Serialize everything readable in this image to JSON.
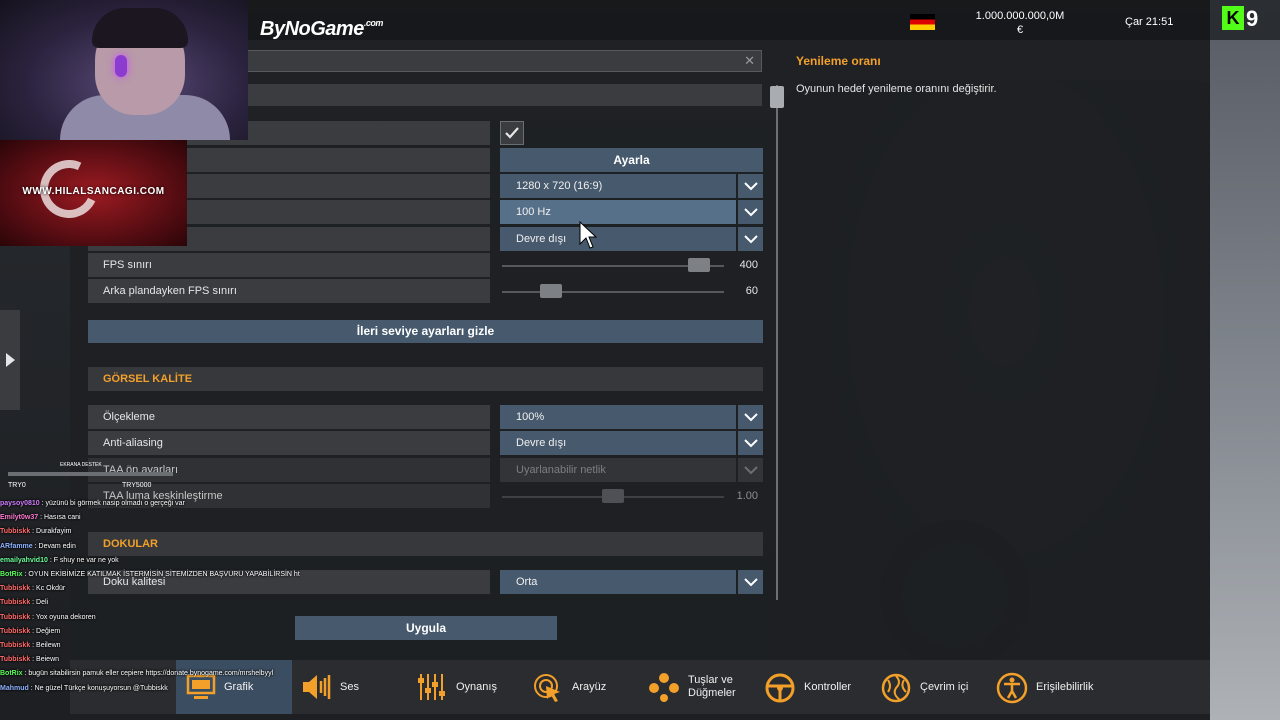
{
  "topbar": {
    "brand": "ByNoGame",
    "brand_suffix": ".com",
    "money": "1.000.000.000,0M",
    "currency": "€",
    "clock": "Çar 21:51"
  },
  "kick": {
    "letter": "K",
    "number": "9"
  },
  "settings": {
    "apply_button": "Ayarla",
    "resolution": "1280 x 720 (16:9)",
    "refresh_rate": "100 Hz",
    "vsync": "Devre dışı",
    "fps_limit_label": "FPS sınırı",
    "fps_limit_value": "400",
    "fps_limit_fraction": 0.93,
    "bg_fps_label": "Arka plandayken FPS sınırı",
    "bg_fps_value": "60",
    "bg_fps_fraction": 0.19,
    "advanced_toggle": "İleri seviye ayarları gizle",
    "section_visual": "GÖRSEL KALİTE",
    "scaling_label": "Ölçekleme",
    "scaling_value": "100%",
    "aa_label": "Anti-aliasing",
    "aa_value": "Devre dışı",
    "taa_preset_label": "TAA ön ayarları",
    "taa_preset_value": "Uyarlanabilir netlik",
    "taa_sharpen_label": "TAA luma keskinleştirme",
    "taa_sharpen_value": "1.00",
    "taa_sharpen_fraction": 0.5,
    "section_textures": "DOKULAR",
    "texture_quality_label": "Doku kalitesi",
    "texture_quality_value": "Orta",
    "apply": "Uygula"
  },
  "description": {
    "title": "Yenileme oranı",
    "text": "Oyunun hedef yenileme oranını değiştirir."
  },
  "nav": [
    {
      "label": "Grafik",
      "icon": "monitor-icon"
    },
    {
      "label": "Ses",
      "icon": "speaker-icon"
    },
    {
      "label": "Oynanış",
      "icon": "sliders-icon"
    },
    {
      "label": "Arayüz",
      "icon": "cursor-icon"
    },
    {
      "label_1": "Tuşlar ve",
      "label_2": "Düğmeler",
      "icon": "buttons-icon"
    },
    {
      "label": "Kontroller",
      "icon": "steering-wheel-icon"
    },
    {
      "label": "Çevrim içi",
      "icon": "globe-icon"
    },
    {
      "label": "Erişilebilirlik",
      "icon": "accessibility-icon"
    }
  ],
  "stream": {
    "banner_text": "WWW.HILALSANCAGI.COM",
    "donation_title": "EKRANA DESTEK",
    "donation_left": "TRY0",
    "donation_right": "TRY5000",
    "chat": [
      {
        "user": "paysoy0810",
        "text": "yüzünü bi görmek nasip olmadı o gerçeği var",
        "color": "#d17dff"
      },
      {
        "user": "Emilyt0w37",
        "text": "Hasısa cani",
        "color": "#ff7bd2"
      },
      {
        "user": "Tubbiskk",
        "text": "Durakfayim",
        "color": "#ff6a6a"
      },
      {
        "user": "ARfamme",
        "text": "Devam edin",
        "color": "#8fb3ff"
      },
      {
        "user": "emailyahvid10",
        "text": "F shuy ne var ne yok",
        "color": "#6bff9a"
      },
      {
        "user": "BotRix",
        "text": "OYUN EKİBİMİZE KATILMAK İSTERMİSİN SİTEMİZDEN BAŞVURU YAPABİLİRSİN https://hilalsancagi.com/",
        "color": "#5cff5c"
      },
      {
        "user": "Tubbiskk",
        "text": "Kc Okdür",
        "color": "#ff6a6a"
      },
      {
        "user": "Tubbiskk",
        "text": "Deli",
        "color": "#ff6a6a"
      },
      {
        "user": "Tubbiskk",
        "text": "Yox oyuna dekoren",
        "color": "#ff6a6a"
      },
      {
        "user": "Tubbiskk",
        "text": "Değiem",
        "color": "#ff6a6a"
      },
      {
        "user": "Tubbiskk",
        "text": "Beilewn",
        "color": "#ff6a6a"
      },
      {
        "user": "Tubbiskk",
        "text": "Beiewn",
        "color": "#ff6a6a"
      },
      {
        "user": "BotRix",
        "text": "bugün sitabilirsin pamuk eller cepiere https://donate.bynogame.com/mrshelbyyl",
        "color": "#5cff5c"
      },
      {
        "user": "Mahmud",
        "text": "Ne güzel Türkçe konuşuyorsun @Tubbiskk",
        "color": "#8fb3ff"
      }
    ]
  }
}
